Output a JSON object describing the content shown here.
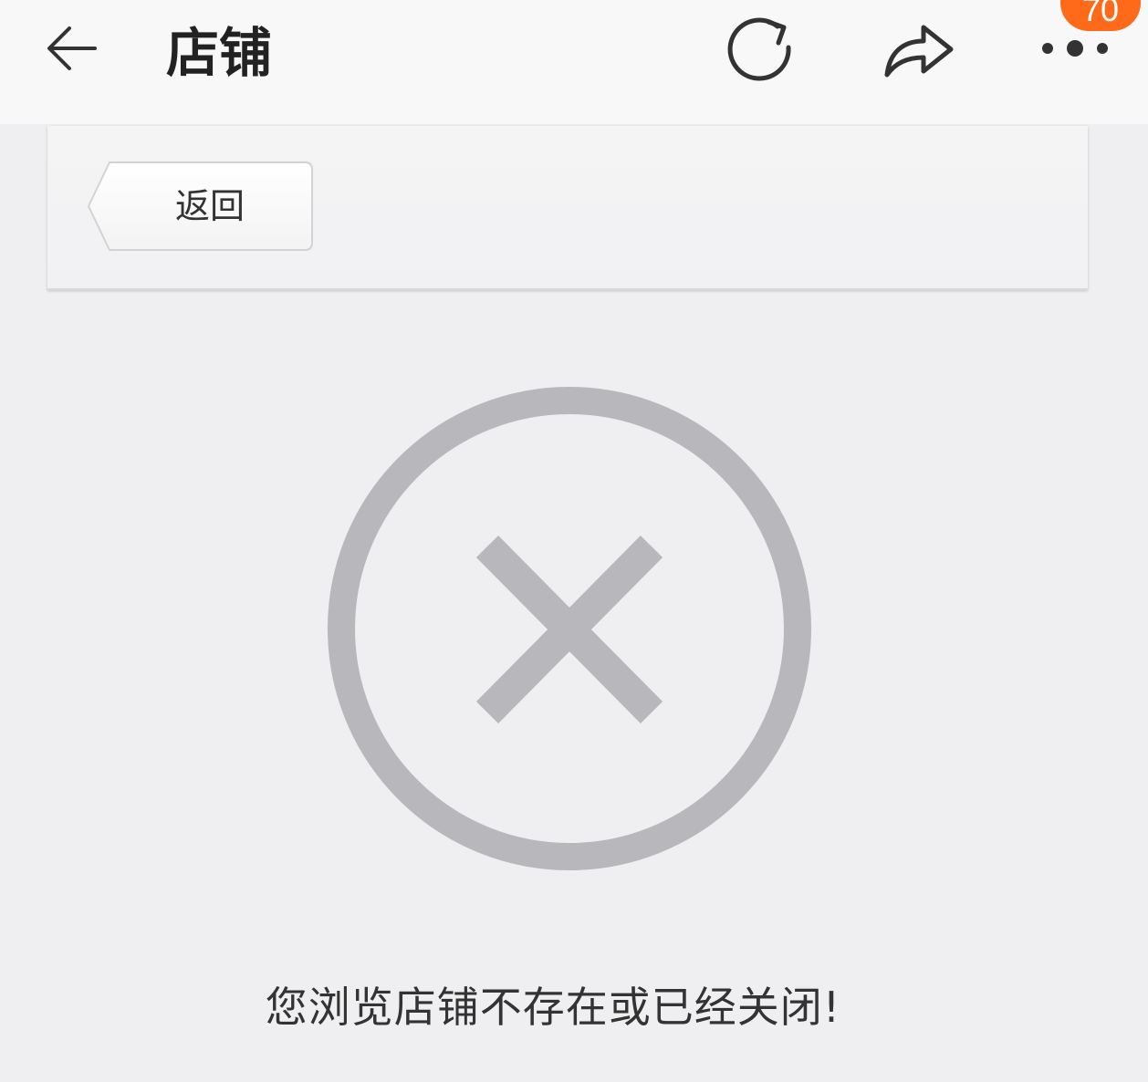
{
  "header": {
    "title": "店铺",
    "badge": "70",
    "icons": [
      "back-arrow-icon",
      "refresh-icon",
      "share-icon",
      "more-icon"
    ]
  },
  "panel": {
    "back_label": "返回"
  },
  "main": {
    "icon": "close-circle-icon",
    "message": "您浏览店铺不存在或已经关闭!"
  },
  "colors": {
    "background": "#efeff1",
    "badge": "#ff6a1a",
    "error_icon": "#b8b8bc"
  }
}
